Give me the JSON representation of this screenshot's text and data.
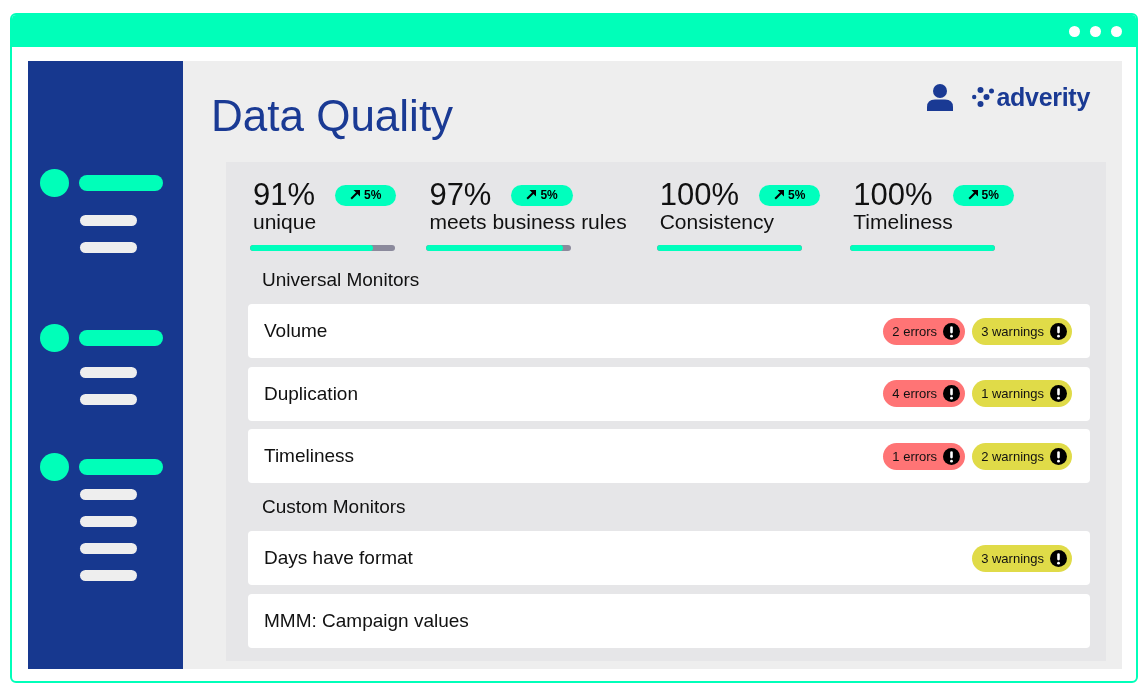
{
  "page": {
    "title": "Data Quality"
  },
  "header": {
    "logo": "adverity"
  },
  "stats": [
    {
      "value": "91%",
      "label": "unique",
      "change": "5%",
      "level": 0.85
    },
    {
      "value": "97%",
      "label": "meets business rules",
      "change": "5%",
      "level": 0.94
    },
    {
      "value": "100%",
      "label": "Consistency",
      "change": "5%",
      "level": 1
    },
    {
      "value": "100%",
      "label": "Timeliness",
      "change": "5%",
      "level": 1
    }
  ],
  "sections": [
    {
      "title": "Universal Monitors",
      "monitors": [
        {
          "name": "Volume",
          "alerts": [
            {
              "kind": "error",
              "text": "2 errors"
            },
            {
              "kind": "warning",
              "text": "3 warnings"
            }
          ]
        },
        {
          "name": "Duplication",
          "alerts": [
            {
              "kind": "error",
              "text": "4 errors"
            },
            {
              "kind": "warning",
              "text": "1 warnings"
            }
          ]
        },
        {
          "name": "Timeliness",
          "alerts": [
            {
              "kind": "error",
              "text": "1 errors"
            },
            {
              "kind": "warning",
              "text": "2 warnings"
            }
          ]
        }
      ]
    },
    {
      "title": "Custom Monitors",
      "monitors": [
        {
          "name": "Days have format",
          "alerts": [
            {
              "kind": "warning",
              "text": "3 warnings"
            }
          ]
        },
        {
          "name": "MMM: Campaign values"
        }
      ]
    }
  ]
}
